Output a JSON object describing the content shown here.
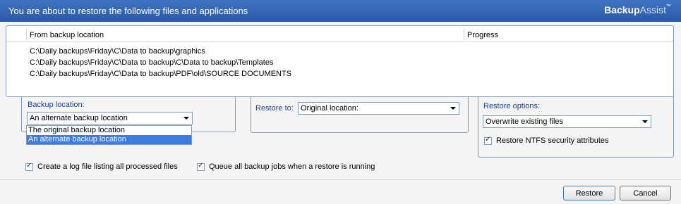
{
  "header": {
    "title": "You are about to restore the following files and applications",
    "brand_main": "Backup",
    "brand_light": "Assist",
    "brand_tm": "™"
  },
  "files_table": {
    "columns": [
      "From backup location",
      "Progress"
    ],
    "rows": [
      "C:\\Daily backups\\Friday\\C\\Data to backup\\graphics",
      "C:\\Daily backups\\Friday\\C\\Data to backup\\C\\Data to backup\\Templates",
      "C:\\Daily backups\\Friday\\C\\Data to backup\\PDF\\old\\SOURCE DOCUMENTS"
    ]
  },
  "backup_location": {
    "label": "Backup location:",
    "selected": "An alternate backup location",
    "options": [
      "The original backup location",
      "An alternate backup location"
    ]
  },
  "restore_to": {
    "label": "Restore to:",
    "selected": "Original location:"
  },
  "restore_options": {
    "label": "Restore options:",
    "selected": "Overwrite existing files",
    "ntfs_label": "Restore NTFS security attributes",
    "ntfs_checked": true
  },
  "log_checkbox": {
    "label": "Create a log file listing all processed files",
    "checked": true
  },
  "queue_checkbox": {
    "label": "Queue all backup jobs when a restore is running",
    "checked": true
  },
  "buttons": {
    "restore": "Restore",
    "cancel": "Cancel"
  },
  "colors": {
    "header": "#2f61b0",
    "accent_label": "#1c3f94",
    "selection": "#3a7de0"
  }
}
